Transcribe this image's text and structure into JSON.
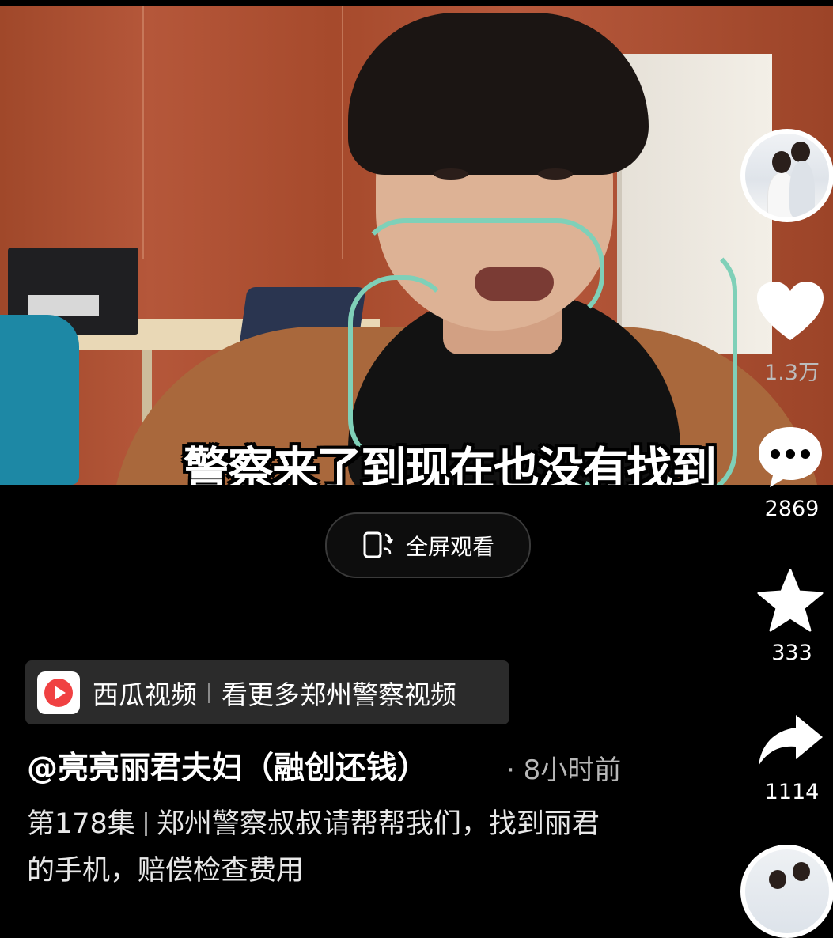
{
  "video": {
    "subtitle": "警察来了到现在也没有找到",
    "fullscreen_label": "全屏观看"
  },
  "rail": {
    "like_count": "1.3万",
    "comment_count": "2869",
    "favorite_count": "333",
    "share_count": "1114"
  },
  "source": {
    "app_name": "西瓜视频",
    "link_text": "看更多郑州警察视频"
  },
  "post": {
    "author": "@亮亮丽君夫妇（融创还钱）",
    "time": "· 8小时前",
    "episode": "第178集",
    "caption_line1": "郑州警察叔叔请帮帮我们，找到丽君",
    "caption_line2": "的手机，赔偿检查费用"
  },
  "icons": {
    "fullscreen": "rotate-phone-icon",
    "like": "heart-icon",
    "comment": "comment-bubble-icon",
    "favorite": "star-icon",
    "share": "share-arrow-icon",
    "source_logo": "xigua-video-logo"
  },
  "colors": {
    "background": "#000000",
    "pill_background": "#2b2b2b",
    "xigua_red": "#f04142",
    "secondary_text": "#b8b8b8"
  }
}
